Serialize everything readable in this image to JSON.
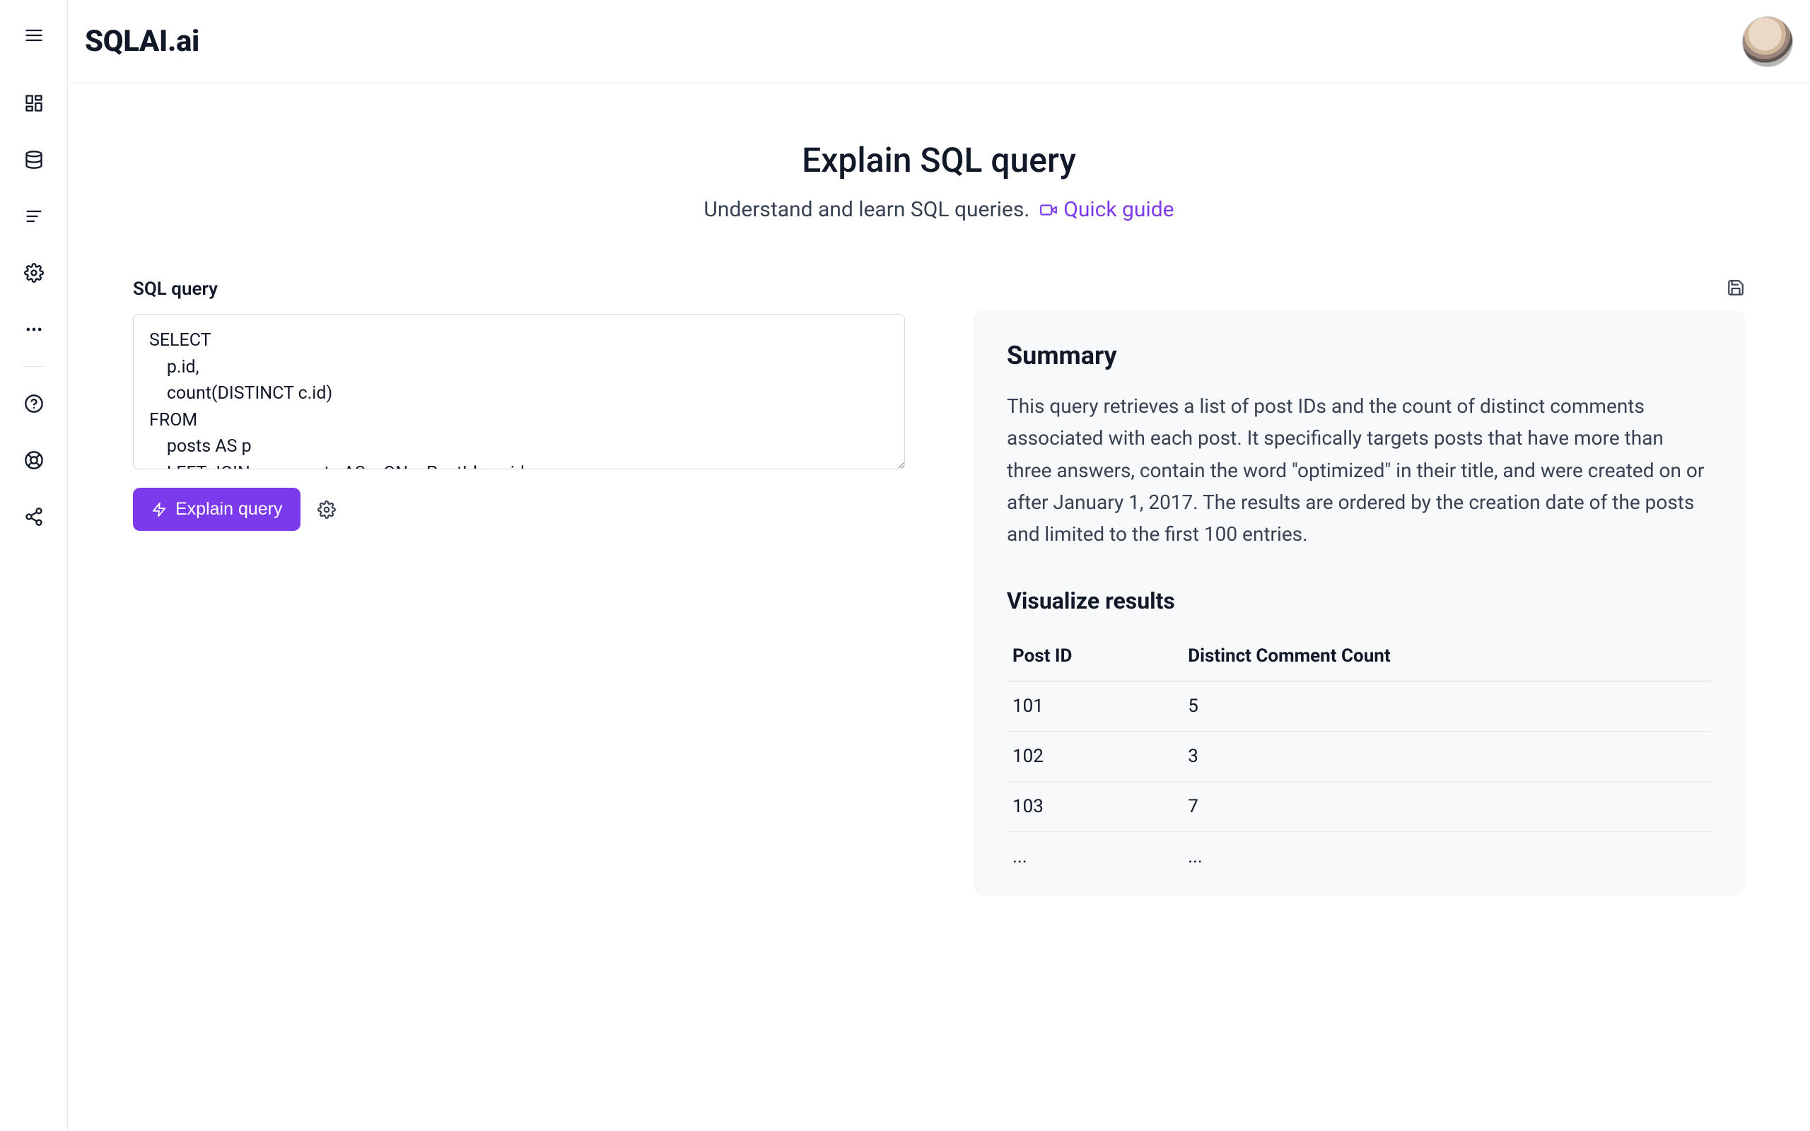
{
  "brand": "SQLAI.ai",
  "hero": {
    "title": "Explain SQL query",
    "subtitle": "Understand and learn SQL queries.",
    "quick_guide": "Quick guide"
  },
  "input": {
    "label": "SQL query",
    "value": "SELECT\n    p.id,\n    count(DISTINCT c.id)\nFROM\n    posts AS p\n    LEFT JOIN comments AS c ON c.PostId = p.id"
  },
  "actions": {
    "explain_label": "Explain query"
  },
  "summary": {
    "heading": "Summary",
    "text": "This query retrieves a list of post IDs and the count of distinct comments associated with each post. It specifically targets posts that have more than three answers, contain the word \"optimized\" in their title, and were created on or after January 1, 2017. The results are ordered by the creation date of the posts and limited to the first 100 entries."
  },
  "results": {
    "heading": "Visualize results",
    "columns": [
      "Post ID",
      "Distinct Comment Count"
    ],
    "rows": [
      [
        "101",
        "5"
      ],
      [
        "102",
        "3"
      ],
      [
        "103",
        "7"
      ],
      [
        "...",
        "..."
      ]
    ]
  },
  "icons": {
    "menu": "menu-icon",
    "dashboard": "dashboard-icon",
    "database": "database-icon",
    "queries": "text-lines-icon",
    "settings": "gear-icon",
    "more": "ellipsis-icon",
    "help": "help-circle-icon",
    "support": "lifebuoy-icon",
    "share": "share-icon",
    "video": "video-icon",
    "bolt": "bolt-icon",
    "save": "save-icon"
  },
  "colors": {
    "accent": "#7c3aed"
  }
}
